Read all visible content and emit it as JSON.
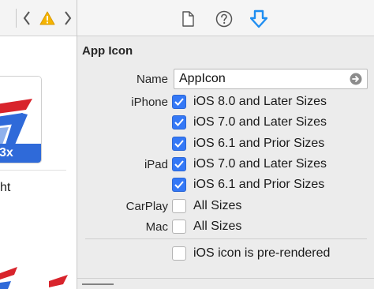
{
  "toolbar": {
    "icons": [
      "chevron-left-icon",
      "warning-icon",
      "chevron-right-icon"
    ],
    "warning_color": "#f5b400"
  },
  "left_pane": {
    "icon_caption": "3x",
    "text_fragment": "ht"
  },
  "inspector": {
    "tabs": [
      {
        "icon": "file-icon"
      },
      {
        "icon": "help-icon"
      },
      {
        "icon": "attributes-icon",
        "selected": true,
        "color": "#1f8ef1"
      }
    ],
    "section_title": "App Icon",
    "name_label": "Name",
    "name_value": "AppIcon",
    "rows": [
      {
        "group": "iPhone",
        "label": "iOS 8.0 and Later Sizes",
        "checked": true
      },
      {
        "group": "",
        "label": "iOS 7.0 and Later Sizes",
        "checked": true
      },
      {
        "group": "",
        "label": "iOS 6.1 and Prior Sizes",
        "checked": true
      },
      {
        "group": "iPad",
        "label": "iOS 7.0 and Later Sizes",
        "checked": true
      },
      {
        "group": "",
        "label": "iOS 6.1 and Prior Sizes",
        "checked": true
      },
      {
        "group": "CarPlay",
        "label": "All Sizes",
        "checked": false
      },
      {
        "group": "Mac",
        "label": "All Sizes",
        "checked": false
      }
    ],
    "prerendered": {
      "label": "iOS icon is pre-rendered",
      "checked": false
    },
    "checkbox_color": "#3478f6"
  }
}
